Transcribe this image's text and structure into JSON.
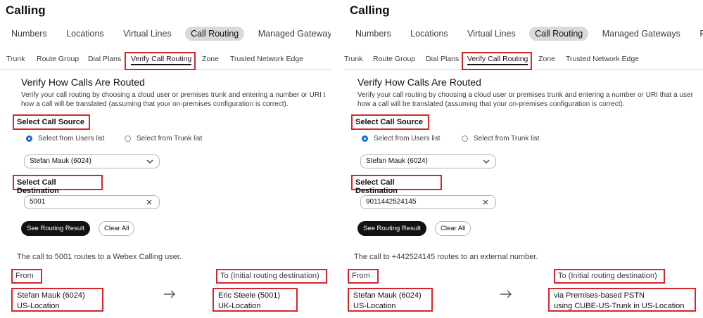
{
  "panels": [
    {
      "app_title": "Calling",
      "top_tabs": [
        "Numbers",
        "Locations",
        "Virtual Lines",
        "Call Routing",
        "Managed Gateways"
      ],
      "sub_tabs": [
        "Trunk",
        "Route Group",
        "Dial Plans",
        "Verify Call Routing",
        "Zone",
        "Trusted Network Edge"
      ],
      "section_title": "Verify How Calls Are Routed",
      "description_line1": "Verify your call routing by choosing a cloud user or premises trunk and entering a number or URI t",
      "description_line2": "how a call will be translated (assuming that your on-premises configuration is correct).",
      "source_label": "Select Call Source",
      "radio_users": "Select from Users list",
      "radio_trunk": "Select from Trunk list",
      "source_value": "Stefan Mauk (6024)",
      "destination_label": "Select Call Destination",
      "destination_value": "5001",
      "see_result_label": "See Routing Result",
      "clear_all_label": "Clear All",
      "result_text": "The call to 5001 routes to a Webex Calling user.",
      "from_label": "From",
      "to_label": "To (Initial routing destination)",
      "from_line1": "Stefan Mauk (6024)",
      "from_line2": "US-Location",
      "to_line1": "Eric Steele (5001)",
      "to_line2": "UK-Location"
    },
    {
      "app_title": "Calling",
      "top_tabs": [
        "Numbers",
        "Locations",
        "Virtual Lines",
        "Call Routing",
        "Managed Gateways",
        "Features"
      ],
      "sub_tabs": [
        "Trunk",
        "Route Group",
        "Dial Plans",
        "Verify Call Routing",
        "Zone",
        "Trusted Network Edge"
      ],
      "section_title": "Verify How Calls Are Routed",
      "description_line1": "Verify your call routing by choosing a cloud user or premises trunk and entering a number or URI that a user",
      "description_line2": "how a call will be translated (assuming that your on-premises configuration is correct).",
      "source_label": "Select Call Source",
      "radio_users": "Select from Users list",
      "radio_trunk": "Select from Trunk list",
      "source_value": "Stefan Mauk (6024)",
      "destination_label": "Select Call Destination",
      "destination_value": "9011442524145",
      "see_result_label": "See Routing Result",
      "clear_all_label": "Clear All",
      "result_text": "The call to +442524145 routes to an external number.",
      "from_label": "From",
      "to_label": "To (Initial routing destination)",
      "from_line1": "Stefan Mauk (6024)",
      "from_line2": "US-Location",
      "to_line1": "via Premises-based PSTN",
      "to_line2": "using CUBE-US-Trunk in US-Location"
    }
  ],
  "icons": {
    "chevron": "chevron-down-icon",
    "clear": "clear-x-icon",
    "arrow": "right-arrow-icon"
  },
  "colors": {
    "highlight_red": "#d7262a",
    "radio_blue": "#1170cf",
    "active_tab_bg": "#d9d9d9",
    "primary_button": "#121212"
  }
}
